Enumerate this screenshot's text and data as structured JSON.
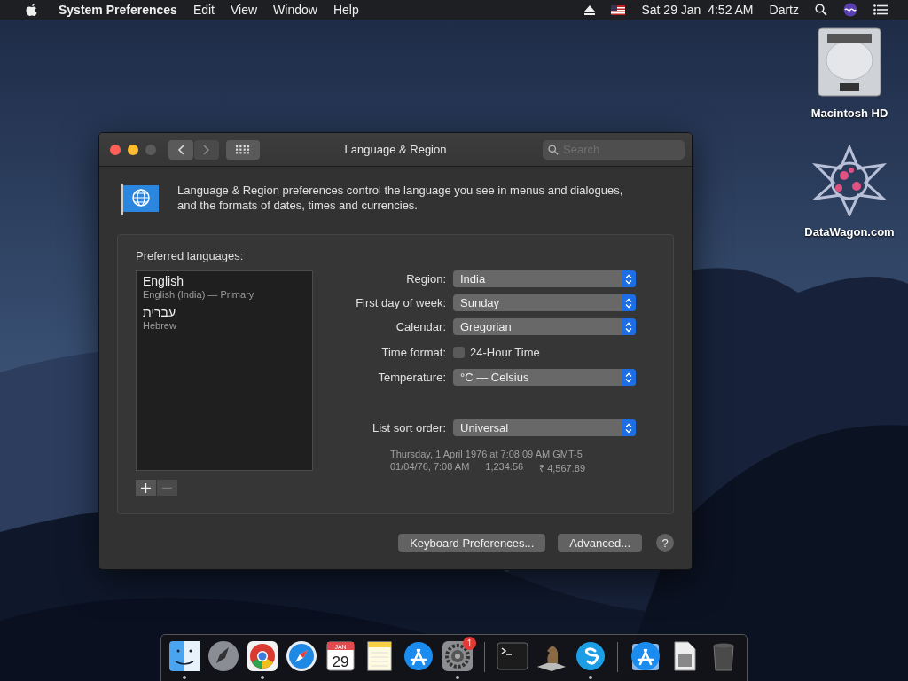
{
  "menu_bar": {
    "app_name": "System Preferences",
    "menus": [
      "Edit",
      "View",
      "Window",
      "Help"
    ],
    "clock": "Sat 29 Jan  4:52 AM",
    "user": "Dartz"
  },
  "desktop_icons": [
    {
      "label": "Macintosh HD",
      "kind": "disk"
    },
    {
      "label": "DataWagon.com",
      "kind": "star"
    }
  ],
  "window": {
    "title": "Language & Region",
    "search": {
      "placeholder": "Search"
    },
    "description": "Language & Region preferences control the language you see in menus and dialogues, and the formats of dates, times and currencies.",
    "preferred_languages": {
      "label": "Preferred languages:",
      "languages": [
        {
          "name": "English",
          "detail": "English (India) — Primary"
        },
        {
          "name": "עברית",
          "detail": "Hebrew"
        }
      ]
    },
    "settings": [
      {
        "label": "Region:",
        "kind": "popup",
        "value": "India"
      },
      {
        "label": "First day of week:",
        "kind": "popup",
        "value": "Sunday"
      },
      {
        "label": "Calendar:",
        "kind": "popup",
        "value": "Gregorian"
      },
      {
        "label": "Time format:",
        "kind": "checkbox",
        "value": "24-Hour Time",
        "checked": false
      },
      {
        "label": "Temperature:",
        "kind": "popup",
        "value": "°C — Celsius"
      },
      {
        "label": "List sort order:",
        "kind": "popup",
        "value": "Universal"
      }
    ],
    "sample": {
      "long_date": "Thursday, 1 April 1976 at 7:08:09 AM GMT-5",
      "short_date": "01/04/76, 7:08 AM",
      "number": "1,234.56",
      "currency": "₹ 4,567.89"
    },
    "buttons": [
      "Keyboard Preferences...",
      "Advanced..."
    ],
    "help": "?"
  },
  "dock": [
    {
      "kind": "finder",
      "running": true
    },
    {
      "kind": "launchpad",
      "running": false
    },
    {
      "kind": "chrome",
      "running": true
    },
    {
      "kind": "safari",
      "running": false
    },
    {
      "kind": "calendar",
      "running": false,
      "month": "JAN",
      "day": "29"
    },
    {
      "kind": "notes",
      "running": false
    },
    {
      "kind": "appstore",
      "running": false
    },
    {
      "kind": "settings",
      "running": true,
      "badge": "1"
    },
    {
      "kind": "separator"
    },
    {
      "kind": "terminal",
      "running": false
    },
    {
      "kind": "chess",
      "running": false
    },
    {
      "kind": "skype",
      "running": true
    },
    {
      "kind": "separator"
    },
    {
      "kind": "downloads",
      "running": false
    },
    {
      "kind": "document",
      "running": false
    },
    {
      "kind": "trash",
      "running": false
    }
  ]
}
